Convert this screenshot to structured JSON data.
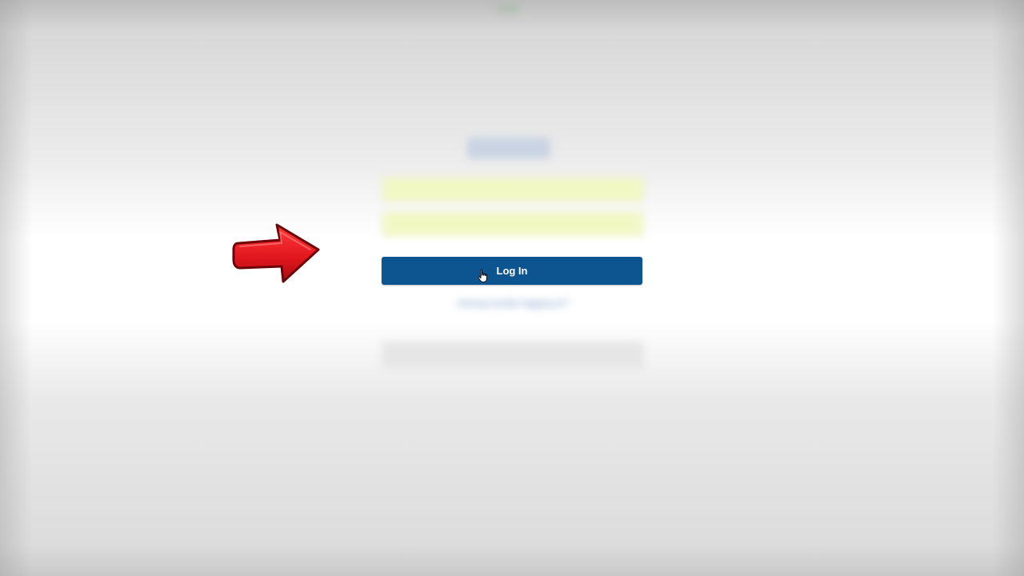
{
  "login_form": {
    "username_placeholder": "",
    "password_placeholder": "",
    "show_password_label": "",
    "login_button_label": "Log In",
    "trouble_link_label": "Having trouble logging in?",
    "or_separator": "",
    "secondary_button_label": ""
  },
  "icons": {
    "pointer": "hand-cursor-icon",
    "annotation": "red-arrow-icon"
  },
  "colors": {
    "login_button": "#0d5591",
    "autofill_field": "#f2f8c4",
    "link": "#6a8fc4",
    "arrow": "#e0161e"
  }
}
